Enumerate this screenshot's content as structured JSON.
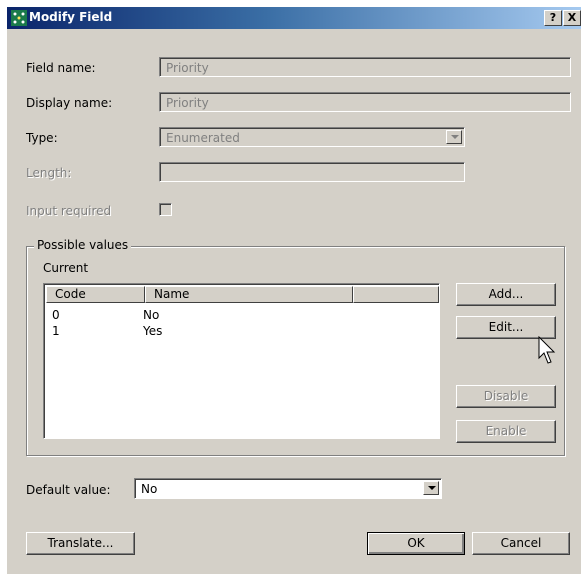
{
  "window": {
    "title": "Modify Field",
    "help_button": "?",
    "close_button": "X"
  },
  "form": {
    "field_name_label": "Field name:",
    "field_name_value": "Priority",
    "display_name_label": "Display name:",
    "display_name_value": "Priority",
    "type_label": "Type:",
    "type_value": "Enumerated",
    "length_label": "Length:",
    "length_value": "",
    "input_required_label": "Input required"
  },
  "possible_values": {
    "group_title": "Possible values",
    "current_label": "Current",
    "columns": [
      "Code",
      "Name",
      ""
    ],
    "rows": [
      {
        "code": "0",
        "name": "No"
      },
      {
        "code": "1",
        "name": "Yes"
      }
    ],
    "buttons": {
      "add": "Add...",
      "edit": "Edit...",
      "disable": "Disable",
      "enable": "Enable"
    }
  },
  "default_value": {
    "label": "Default value:",
    "value": "No"
  },
  "footer": {
    "translate": "Translate...",
    "ok": "OK",
    "cancel": "Cancel"
  },
  "colors": {
    "dialog_face": "#d4d0c8",
    "title_start": "#0a246a",
    "title_end": "#a6caf0",
    "disabled_text": "#808080"
  }
}
